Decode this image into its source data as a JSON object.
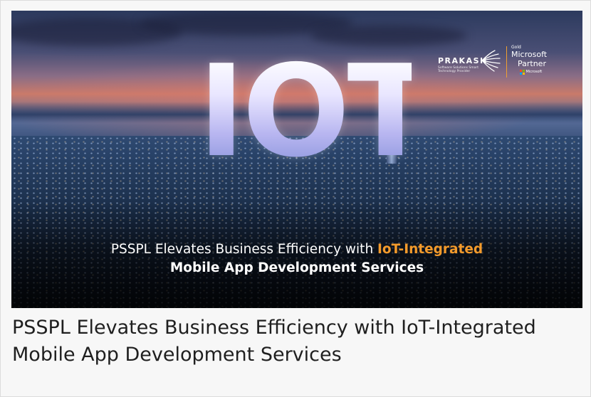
{
  "banner": {
    "hero_word": "IOT",
    "caption_line1_prefix": "PSSPL Elevates Business Efficiency with ",
    "caption_line1_highlight": "IoT-Integrated",
    "caption_line2": "Mobile App Development Services",
    "highlight_color": "#f39a2b"
  },
  "logo": {
    "brand": "PRAKASH",
    "tagline": "Software Solutions Smart Technology Provider",
    "tier": "Gold",
    "partner_name": "Microsoft",
    "partner_label": "Partner",
    "ms_wordmark": "Microsoft",
    "icon": "sunburst-icon",
    "divider_color": "#f0a030"
  },
  "article": {
    "title": "PSSPL Elevates Business Efficiency with IoT-Integrated Mobile App Development Services"
  }
}
